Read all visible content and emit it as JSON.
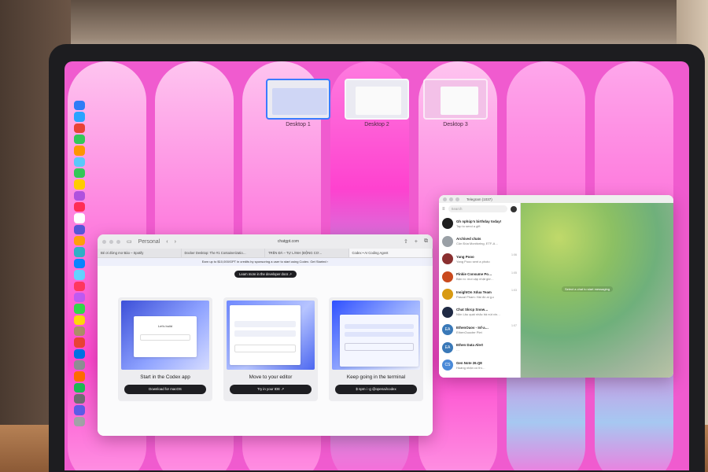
{
  "mission_control": {
    "desktops": [
      {
        "label": "Desktop 1"
      },
      {
        "label": "Desktop 2"
      },
      {
        "label": "Desktop 3"
      }
    ]
  },
  "dock": {
    "icons": [
      "finder-icon",
      "safari-icon",
      "chrome-icon",
      "app-icon",
      "app-icon",
      "app-icon",
      "messages-icon",
      "app-icon",
      "app-icon",
      "app-icon",
      "calendar-icon",
      "app-icon",
      "app-icon",
      "app-icon",
      "app-icon",
      "app-icon",
      "app-icon",
      "app-icon",
      "app-icon",
      "app-icon",
      "app-icon",
      "chrome-icon",
      "app-icon",
      "app-icon",
      "app-icon",
      "app-icon",
      "app-icon",
      "app-icon",
      "trash-icon"
    ]
  },
  "browser": {
    "sidebar_label": "Personal",
    "url": "chatgpt.com",
    "tabs": [
      {
        "label": "Bé ơi đừng mơ Bào – Spotify"
      },
      {
        "label": "Docker Desktop: The #1 Containerizatio…"
      },
      {
        "label": "TRÊN ĐÀ – TỰ LÀNH (ĐỘNG CƠ…"
      },
      {
        "label": "Codex • AI Coding Agent"
      }
    ],
    "banner": "Earn up to $10,000/GPT in credits by sponsoring a user to start using Codex. Get Started ›",
    "dev_pill": "Learn more in the developer docs ↗",
    "cards": [
      {
        "title": "Start in the Codex app",
        "button": "Download for macOS",
        "mock_title": "Let's build"
      },
      {
        "title": "Move to your editor",
        "button": "Try in your IDE ↗"
      },
      {
        "title": "Keep going in the terminal",
        "button": "$ npm i -g @openai/codex"
      }
    ]
  },
  "telegram": {
    "title": "Telegram (1037)",
    "search_placeholder": "Search",
    "empty_hint": "Select a chat to start messaging",
    "chats": [
      {
        "name": "Gh nphúp's birthday today!",
        "message": "Tap to send a gift",
        "time": "",
        "color": "#1e1e1e",
        "initials": ""
      },
      {
        "name": "Archived chats",
        "message": "Cộn Đóa Monitoring, ETF-A…",
        "time": "",
        "color": "#9aa0a6",
        "initials": ""
      },
      {
        "name": "Yang Pooo",
        "message": "Yang Pooo sent a photo",
        "time": "1:06",
        "color": "#8a3030",
        "initials": ""
      },
      {
        "name": "Pinkie Consume Po…",
        "message": "Bận ro: moi cập nhật giờ…",
        "time": "1:05",
        "color": "#c94a1e",
        "initials": ""
      },
      {
        "name": "InsightOn Xdua Team",
        "message": "Pascal Pham: Hái đó ai g.c",
        "time": "1:03",
        "color": "#d89a12",
        "initials": ""
      },
      {
        "name": "Chat Skrcp Snow…",
        "message": "Nôn Lâu quái nhặc bả nút xin…",
        "time": "",
        "color": "#1f2a44",
        "initials": ""
      },
      {
        "name": "EthenOuov - Inf-a…",
        "message": "EthenOuocter Plet",
        "time": "1:07",
        "color": "#3a79b8",
        "initials": "EA"
      },
      {
        "name": "Ethen Data Alert",
        "message": "…",
        "time": "",
        "color": "#3a79b8",
        "initials": "EA"
      },
      {
        "name": "Gen Note 26.Q8",
        "message": "Hoàng nhận có thì…",
        "time": "",
        "color": "#4a8ad8",
        "initials": "CS"
      }
    ]
  }
}
